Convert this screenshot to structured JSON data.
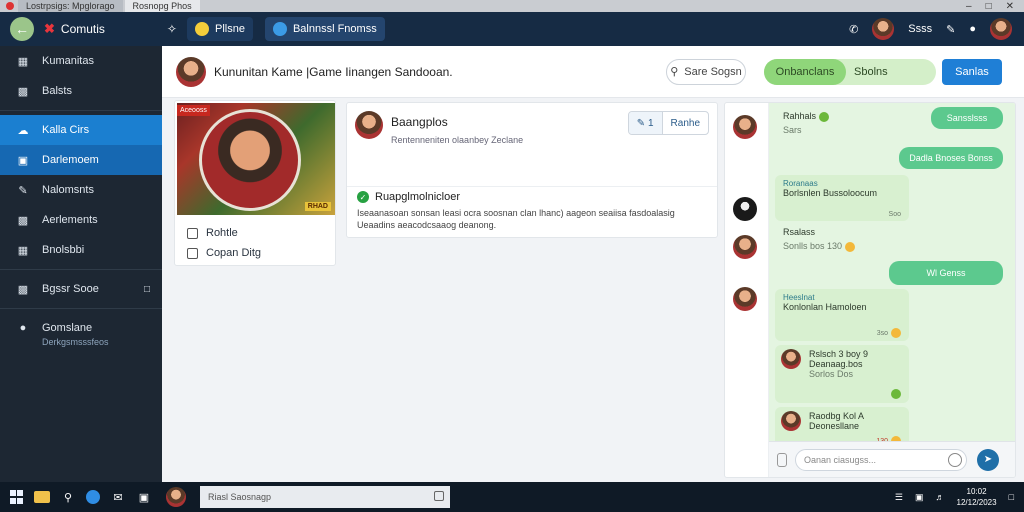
{
  "os_bar": {
    "tabs": [
      {
        "label": "Lostrpsigs: Mpglorago"
      },
      {
        "label": "Rosnopg Phos"
      }
    ]
  },
  "header": {
    "brand": "Comutis",
    "tab_mini": "Pllsne",
    "tab_main": "Balnnssl Fnomss",
    "right_label": "Ssss"
  },
  "sidebar": {
    "items": [
      {
        "label": "Kumanitas"
      },
      {
        "label": "Balsts"
      },
      {
        "label": "Kalla Cirs"
      },
      {
        "label": "Darlemoem"
      },
      {
        "label": "Nalomsnts"
      },
      {
        "label": "Aerlements"
      },
      {
        "label": "Bnolsbbi"
      },
      {
        "label": "Bgssr Sooe"
      },
      {
        "label": "Gomslane"
      }
    ],
    "sub_text": "Derkgsmsssfeos"
  },
  "main": {
    "title": "Kununitan Kame |Game Iinangen Sandooan.",
    "search_label": "Sare Sogsn",
    "pill_left": "Onbanclans",
    "pill_right": "Sbolns",
    "primary_btn": "Sanlas"
  },
  "game_card": {
    "badge": "Aceooss",
    "tag": "RHAD",
    "options": [
      {
        "label": "Rohtle"
      },
      {
        "label": "Copan Ditg"
      }
    ]
  },
  "post": {
    "name": "Baangplos",
    "subtitle": "Rentenneniten olaanbey Zeclane",
    "action_left": "1",
    "action_right": "Ranhe",
    "status": "Ruapglmolnicloer",
    "text_1": "Iseaanasoan sonsan leasi ocra soosnan clan lhanc) aageon seaiisa fasdoalasig",
    "text_2": "Ueaadins aeacodcsaaog deanong."
  },
  "chat": {
    "messages": [
      {
        "sender": "",
        "line1": "Rahhals",
        "line2": "Sars"
      },
      {
        "out": "Sansslsss"
      },
      {
        "out": "Dadla Bnoses Bonss"
      },
      {
        "sender": "Roranaas",
        "line1": "Borlsnlen Bussoloocum",
        "time": "Soo"
      },
      {
        "plain1": "Rsalass",
        "plain2": "Sonlls bos",
        "time": "130"
      },
      {
        "out": "Wl Genss"
      },
      {
        "sender": "Heeslnat",
        "line1": "Konlonlan Hamoloen",
        "time": "3so"
      },
      {
        "line1": "Rslsch 3 boy 9",
        "line2": "Deanaag.bos",
        "line3": "Sorlos Dos"
      },
      {
        "line1": "Raodbg Kol A",
        "line2": "Deonesllane",
        "time": "130"
      }
    ],
    "input_placeholder": "Oanan ciasugss..."
  },
  "taskbar": {
    "search_text": "Riasl Saosnagp",
    "clock_time": "10:02",
    "clock_date": "12/12/2023"
  }
}
